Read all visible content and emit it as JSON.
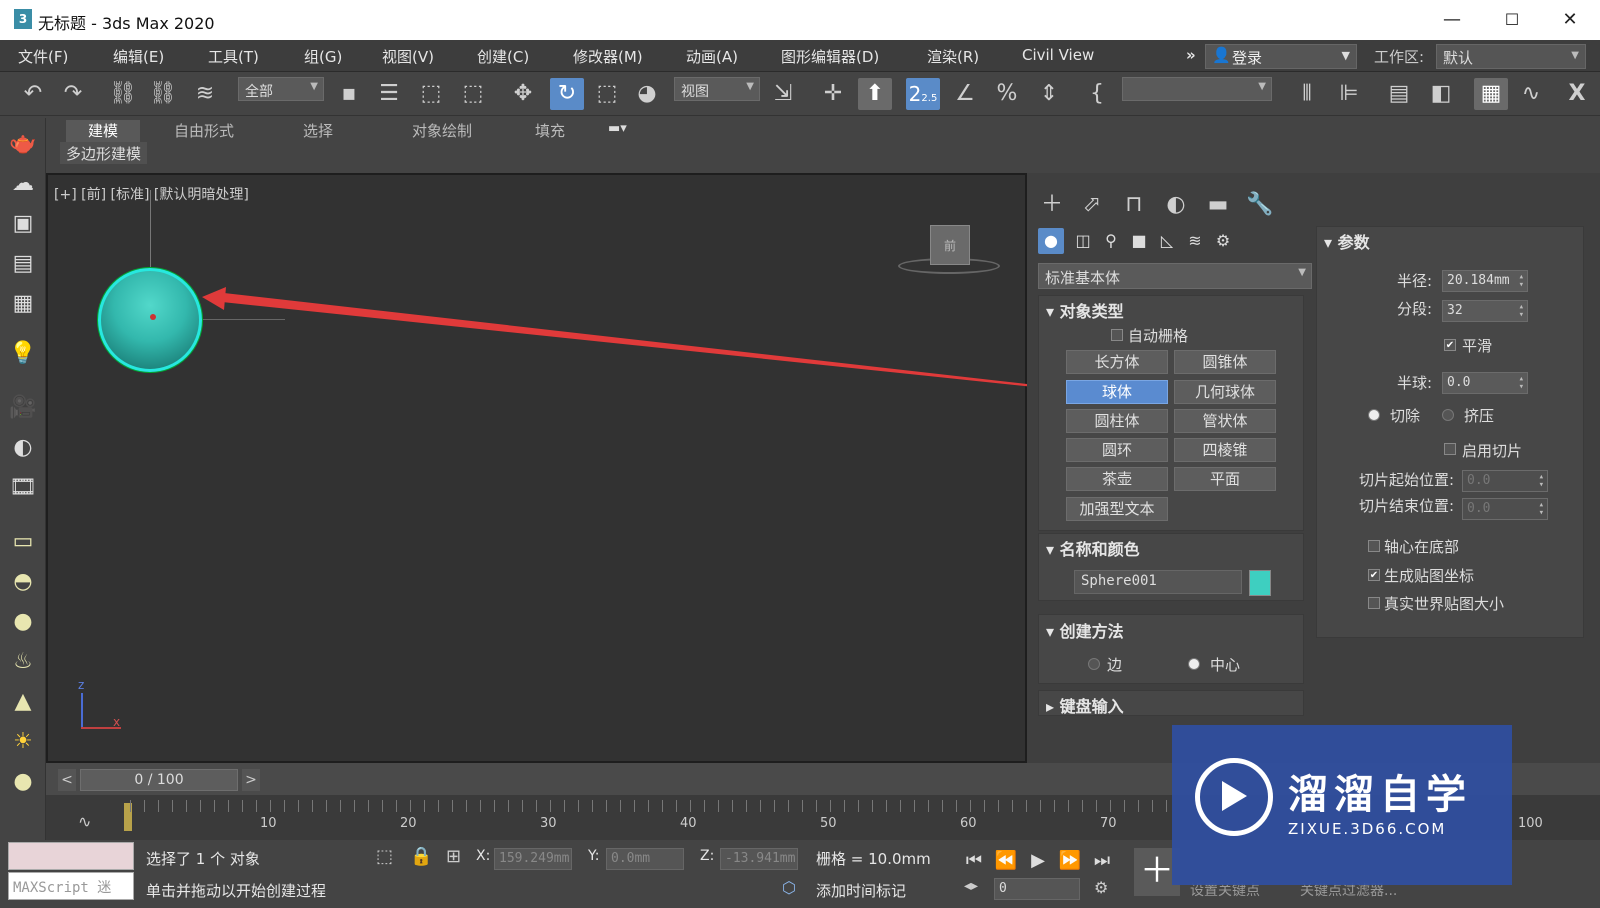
{
  "window": {
    "app_icon": "3",
    "title": "无标题 - 3ds Max 2020",
    "minimize": "—",
    "maximize": "☐",
    "close": "✕"
  },
  "menu": {
    "items": [
      "文件(F)",
      "编辑(E)",
      "工具(T)",
      "组(G)",
      "视图(V)",
      "创建(C)",
      "修改器(M)",
      "动画(A)",
      "图形编辑器(D)",
      "渲染(R)",
      "Civil View"
    ],
    "overflow": "»",
    "login_label": "登录",
    "workspace_label": "工作区:",
    "workspace_value": "默认"
  },
  "toolbar": {
    "selection_filter": "全部",
    "ref_coord": "视图",
    "snap_value": "2.5",
    "named_sel": ""
  },
  "ribbon": {
    "tabs": [
      "建模",
      "自由形式",
      "选择",
      "对象绘制",
      "填充"
    ],
    "subtab": "多边形建模"
  },
  "viewport": {
    "label": "[+] [前] [标准] [默认明暗处理]",
    "viewcube_label": "前",
    "axis_z": "z",
    "axis_x": "x"
  },
  "command_panel": {
    "category_dropdown": "标准基本体",
    "object_type": {
      "title": "对象类型",
      "auto_grid": "自动栅格",
      "buttons": [
        "长方体",
        "圆锥体",
        "球体",
        "几何球体",
        "圆柱体",
        "管状体",
        "圆环",
        "四棱锥",
        "茶壶",
        "平面",
        "加强型文本"
      ],
      "active": "球体"
    },
    "name_color": {
      "title": "名称和颜色",
      "name": "Sphere001",
      "color": "#3ecfc0"
    },
    "creation_method": {
      "title": "创建方法",
      "edge": "边",
      "center": "中心",
      "selected": "中心"
    },
    "keyboard_entry": {
      "title": "键盘输入"
    },
    "params": {
      "title": "参数",
      "radius_label": "半径:",
      "radius": "20.184mm",
      "segments_label": "分段:",
      "segments": "32",
      "smooth_label": "平滑",
      "smooth": true,
      "hemisphere_label": "半球:",
      "hemisphere": "0.0",
      "chop_label": "切除",
      "squash_label": "挤压",
      "enable_slice_label": "启用切片",
      "slice_from_label": "切片起始位置:",
      "slice_from": "0.0",
      "slice_to_label": "切片结束位置:",
      "slice_to": "0.0",
      "base_to_pivot_label": "轴心在底部",
      "gen_map_label": "生成贴图坐标",
      "gen_map": true,
      "real_world_label": "真实世界贴图大小"
    }
  },
  "timeline": {
    "slider": "0 / 100",
    "prev": "<",
    "next": ">",
    "ticks": [
      "10",
      "20",
      "30",
      "40",
      "50",
      "60",
      "70",
      "100"
    ]
  },
  "status": {
    "maxscript_placeholder": "MAXScript 迷",
    "selected": "选择了 1 个 对象",
    "prompt": "单击并拖动以开始创建过程",
    "x_label": "X:",
    "x": "159.249mm",
    "y_label": "Y:",
    "y": "0.0mm",
    "z_label": "Z:",
    "z": "-13.941mm",
    "grid": "栅格 = 10.0mm",
    "add_time_tag": "添加时间标记",
    "frame": "0",
    "set_key": "设置关键点",
    "key_filters": "关键点过滤器..."
  },
  "watermark": {
    "title": "溜溜自学",
    "url": "ZIXUE.3D66.COM"
  },
  "colors": {
    "accent_blue": "#5a8bc8",
    "sphere": "#3ecfc0",
    "arrow": "#e03a3a"
  }
}
